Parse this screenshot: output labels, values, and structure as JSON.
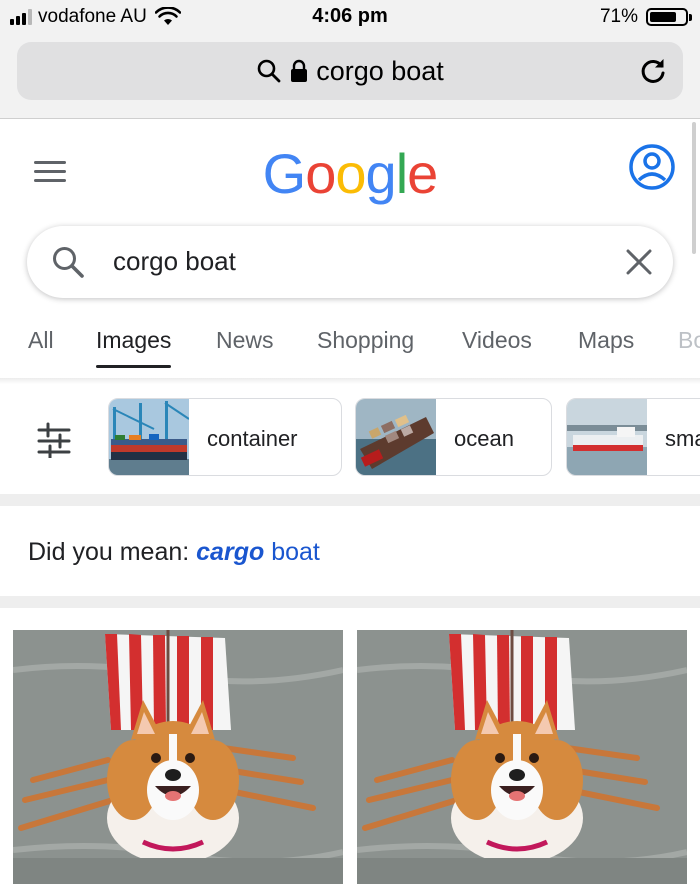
{
  "status_bar": {
    "carrier": "vodafone AU",
    "time": "4:06 pm",
    "battery": "71%",
    "battery_level": 0.71,
    "signal_bars": 3
  },
  "browser": {
    "url_text": "corgo boat",
    "icons": [
      "search-icon",
      "lock-icon",
      "reload-icon"
    ]
  },
  "google": {
    "logo_letters": [
      "G",
      "o",
      "o",
      "g",
      "l",
      "e"
    ],
    "logo_colors": [
      "#4285F4",
      "#EA4335",
      "#FBBC05",
      "#4285F4",
      "#34A853",
      "#EA4335"
    ],
    "search_query": "corgo boat"
  },
  "tabs": [
    {
      "label": "All",
      "active": false
    },
    {
      "label": "Images",
      "active": true
    },
    {
      "label": "News",
      "active": false
    },
    {
      "label": "Shopping",
      "active": false
    },
    {
      "label": "Videos",
      "active": false
    },
    {
      "label": "Maps",
      "active": false
    },
    {
      "label": "Bo",
      "active": false
    }
  ],
  "chips": [
    {
      "label": "container"
    },
    {
      "label": "ocean"
    },
    {
      "label": "sma"
    }
  ],
  "did_you_mean": {
    "prefix": "Did you mean:",
    "correction": "cargo",
    "rest": "boat"
  },
  "colors": {
    "link_blue": "#1a56cf",
    "text": "#202124",
    "muted": "#5f6368"
  }
}
